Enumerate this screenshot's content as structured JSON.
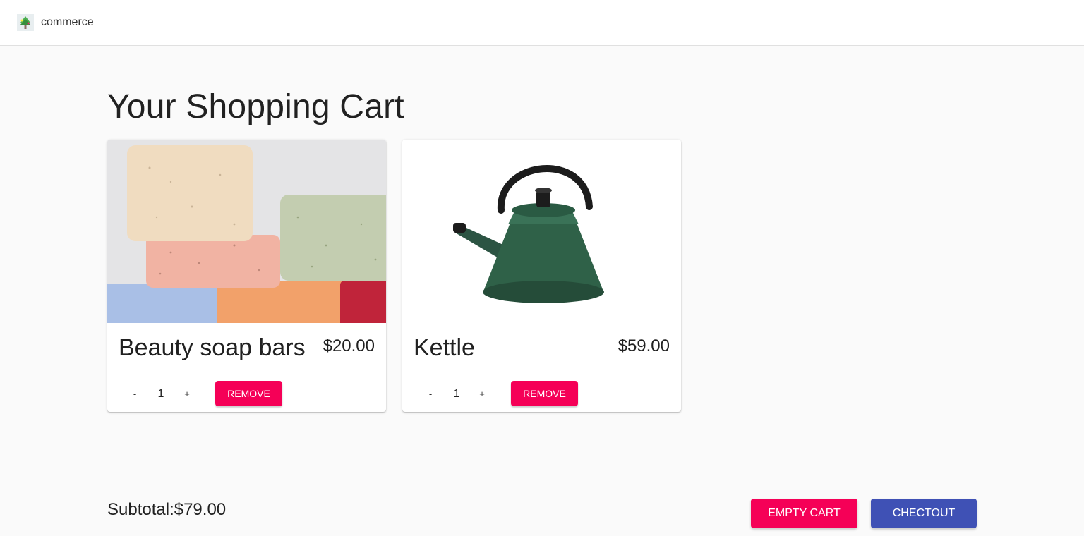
{
  "header": {
    "brand": "commerce",
    "logo_icon": "tree-logo-icon"
  },
  "main": {
    "title": "Your Shopping Cart",
    "items": [
      {
        "name": "Beauty soap bars",
        "price": "$20.00",
        "quantity": "1",
        "minus_label": "-",
        "plus_label": "+",
        "remove_label": "REMOVE",
        "image_alt": "soap-bars-image"
      },
      {
        "name": "Kettle",
        "price": "$59.00",
        "quantity": "1",
        "minus_label": "-",
        "plus_label": "+",
        "remove_label": "REMOVE",
        "image_alt": "kettle-image"
      }
    ]
  },
  "footer": {
    "subtotal": "Subtotal:$79.00",
    "empty_label": "EMPTY CART",
    "checkout_label": "CHECTOUT"
  },
  "colors": {
    "accent": "#f50057",
    "primary": "#3f51b5",
    "background": "#fafafa"
  }
}
